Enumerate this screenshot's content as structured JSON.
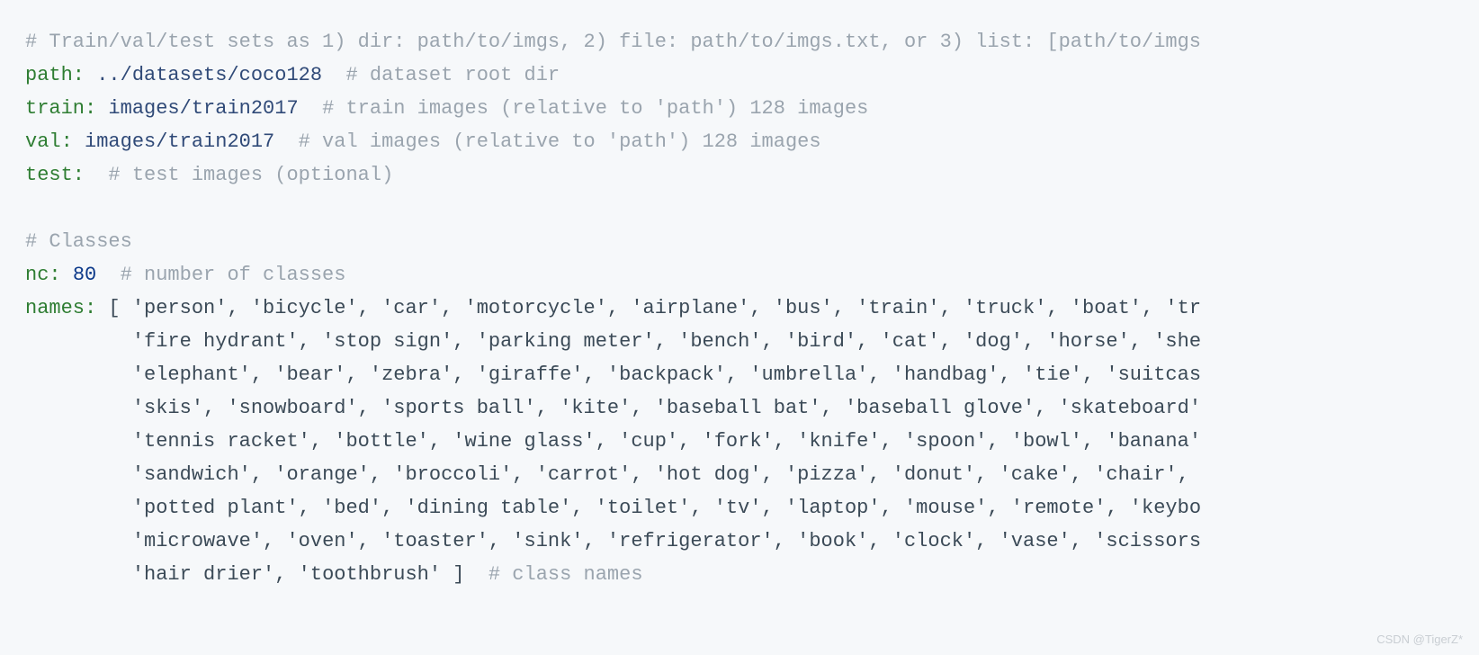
{
  "comments": {
    "header": "# Train/val/test sets as 1) dir: path/to/imgs, 2) file: path/to/imgs.txt, or 3) list: [path/to/imgs",
    "path": "# dataset root dir",
    "train": "# train images (relative to 'path') 128 images",
    "val": "# val images (relative to 'path') 128 images",
    "test": "# test images (optional)",
    "classes_header": "# Classes",
    "nc": "# number of classes",
    "class_names": "# class names"
  },
  "keys": {
    "path": "path:",
    "train": "train:",
    "val": "val:",
    "test": "test:",
    "nc": "nc:",
    "names": "names:"
  },
  "values": {
    "path": "../datasets/coco128",
    "train": "images/train2017",
    "val": "images/train2017",
    "nc": "80"
  },
  "names_open": "[",
  "names_close": "]",
  "name_rows": {
    "r1": "'person', 'bicycle', 'car', 'motorcycle', 'airplane', 'bus', 'train', 'truck', 'boat', 'tr",
    "r2": "'fire hydrant', 'stop sign', 'parking meter', 'bench', 'bird', 'cat', 'dog', 'horse', 'she",
    "r3": "'elephant', 'bear', 'zebra', 'giraffe', 'backpack', 'umbrella', 'handbag', 'tie', 'suitcas",
    "r4": "'skis', 'snowboard', 'sports ball', 'kite', 'baseball bat', 'baseball glove', 'skateboard'",
    "r5": "'tennis racket', 'bottle', 'wine glass', 'cup', 'fork', 'knife', 'spoon', 'bowl', 'banana'",
    "r6": "'sandwich', 'orange', 'broccoli', 'carrot', 'hot dog', 'pizza', 'donut', 'cake', 'chair', ",
    "r7": "'potted plant', 'bed', 'dining table', 'toilet', 'tv', 'laptop', 'mouse', 'remote', 'keybo",
    "r8": "'microwave', 'oven', 'toaster', 'sink', 'refrigerator', 'book', 'clock', 'vase', 'scissors",
    "r9": "'hair drier', 'toothbrush' "
  },
  "watermark": "CSDN @TigerZ*"
}
